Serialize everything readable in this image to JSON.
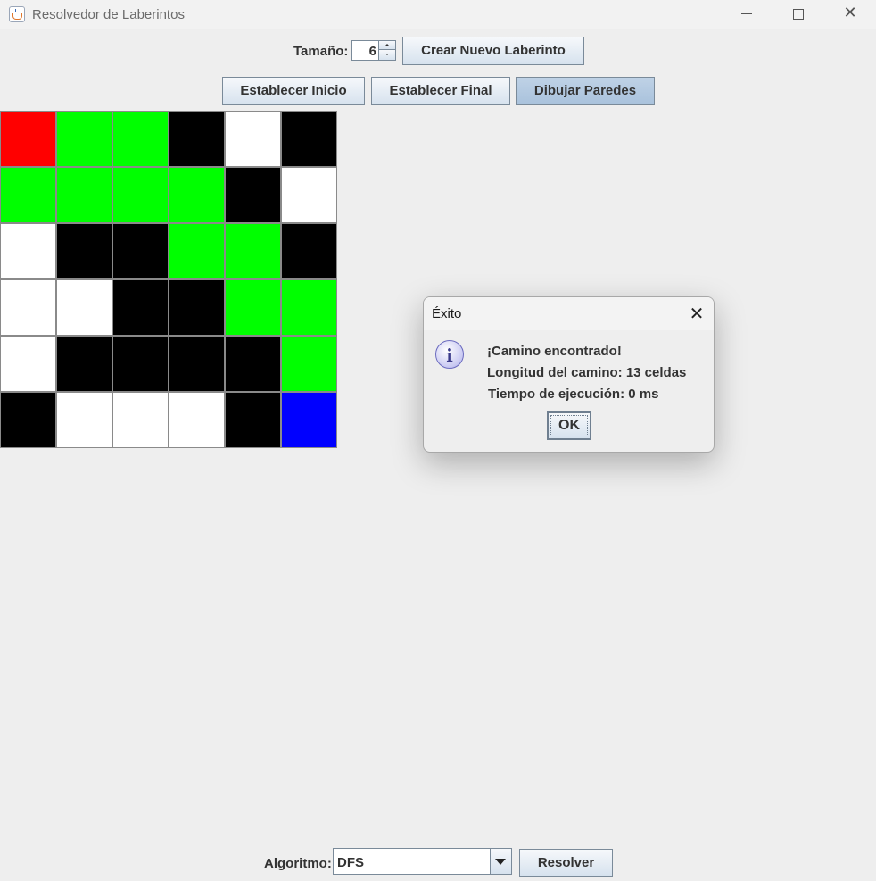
{
  "window": {
    "title": "Resolvedor de Laberintos"
  },
  "toolbar": {
    "size_label": "Tamaño:",
    "size_value": "6",
    "create_button": "Crear Nuevo Laberinto",
    "set_start_button": "Establecer Inicio",
    "set_end_button": "Establecer Final",
    "draw_walls_button": "Dibujar Paredes"
  },
  "maze": {
    "size": 6,
    "colors": {
      "start": "#ff0000",
      "end": "#0000ff",
      "path": "#00ff00",
      "wall": "#000000",
      "empty": "#ffffff"
    },
    "grid": [
      [
        "start",
        "path",
        "path",
        "wall",
        "empty",
        "wall"
      ],
      [
        "path",
        "path",
        "path",
        "path",
        "wall",
        "empty"
      ],
      [
        "empty",
        "wall",
        "wall",
        "path",
        "path",
        "wall"
      ],
      [
        "empty",
        "empty",
        "wall",
        "wall",
        "path",
        "path"
      ],
      [
        "empty",
        "wall",
        "wall",
        "wall",
        "wall",
        "path"
      ],
      [
        "wall",
        "empty",
        "empty",
        "empty",
        "wall",
        "end"
      ]
    ]
  },
  "dialog": {
    "title": "Éxito",
    "icon": "info-icon",
    "message_line1": "¡Camino encontrado!",
    "message_line2": "Longitud del camino: 13 celdas",
    "message_line3": "Tiempo de ejecución: 0 ms",
    "ok_button": "OK"
  },
  "bottom": {
    "algorithm_label": "Algoritmo:",
    "algorithm_selected": "DFS",
    "solve_button": "Resolver"
  }
}
